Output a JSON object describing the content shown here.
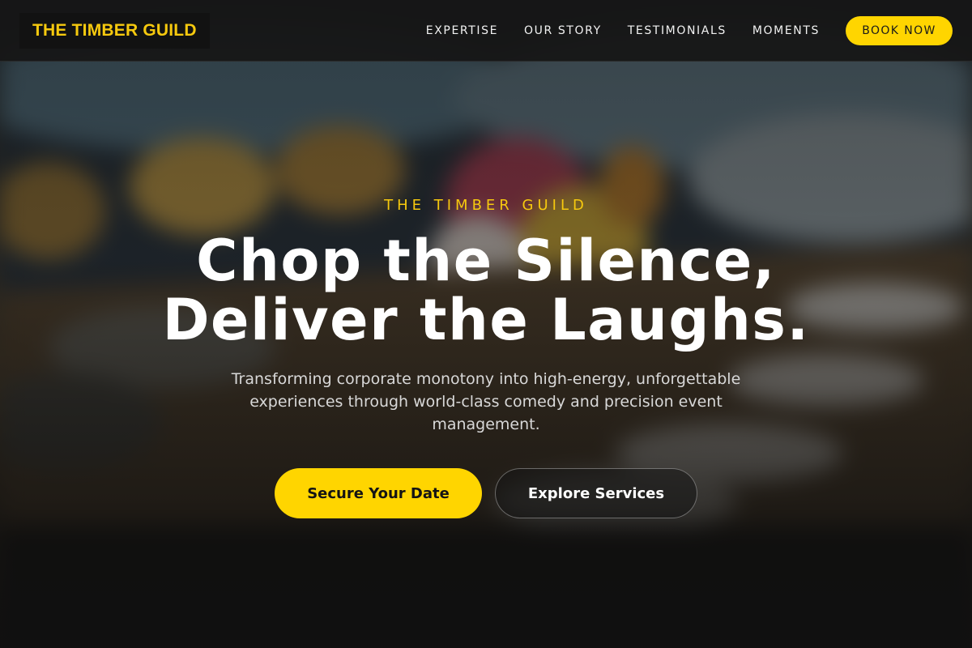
{
  "brand": {
    "logo_text": "THE TIMBER GUILD",
    "accent_color": "#ffd500",
    "logo_color": "#f6c90e"
  },
  "nav": {
    "links": [
      {
        "label": "EXPERTISE"
      },
      {
        "label": "OUR STORY"
      },
      {
        "label": "TESTIMONIALS"
      },
      {
        "label": "MOMENTS"
      }
    ],
    "cta_label": "BOOK NOW"
  },
  "hero": {
    "eyebrow": "THE TIMBER GUILD",
    "headline_line1": "Chop the Silence,",
    "headline_line2": "Deliver the Laughs.",
    "subtext": "Transforming corporate monotony into high-energy, unforgettable experiences through world-class comedy and precision event management.",
    "primary_cta": "Secure Your Date",
    "secondary_cta": "Explore Services"
  }
}
